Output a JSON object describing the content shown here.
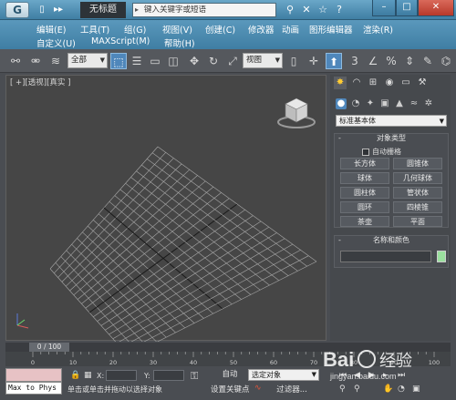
{
  "titlebar": {
    "logo": "G",
    "quick_access": [
      "▯",
      "▸▸"
    ],
    "doc_title": "无标题",
    "search_placeholder": "键入关键字或短语",
    "icons": [
      "binoculars-icon",
      "tools-icon",
      "star-icon",
      "help-icon"
    ],
    "window_buttons": [
      "–",
      "□",
      "✕"
    ]
  },
  "menubar": {
    "row1": [
      "编辑(E)",
      "工具(T)",
      "组(G)",
      "视图(V)",
      "创建(C)",
      "修改器",
      "动画",
      "图形编辑器",
      "渲染(R)"
    ],
    "row2": [
      "自定义(U)",
      "MAXScript(M)",
      "帮助(H)"
    ]
  },
  "toolbar": {
    "selection_filter": "全部",
    "reference_coord": "视图"
  },
  "viewport": {
    "label": "[ +][透视][真实 ]"
  },
  "command_panel": {
    "primitive_type": "标准基本体",
    "object_type": {
      "title": "对象类型",
      "autogrid_label": "自动栅格",
      "buttons": [
        "长方体",
        "圆锥体",
        "球体",
        "几何球体",
        "圆柱体",
        "管状体",
        "圆环",
        "四棱锥",
        "茶壶",
        "平面"
      ]
    },
    "name_color": {
      "title": "名称和颜色",
      "swatch_color": "#9adf9e"
    }
  },
  "timeline": {
    "frame_display": "0 / 100",
    "ticks": [
      "0",
      "10",
      "20",
      "30",
      "40",
      "50",
      "60",
      "70",
      "80",
      "90",
      "100"
    ]
  },
  "statusbar": {
    "script_text": "Max to Phys",
    "x_label": "X:",
    "y_label": "Y:",
    "prompt": "单击或单击并拖动以选择对象",
    "auto_key": "自动",
    "set_key": "设置关键点",
    "selected_dropdown": "选定对象",
    "filters": "过滤器..."
  },
  "watermark": {
    "text": "Bai",
    "subtext": "经验",
    "url": "jingyan.baidu.com"
  }
}
